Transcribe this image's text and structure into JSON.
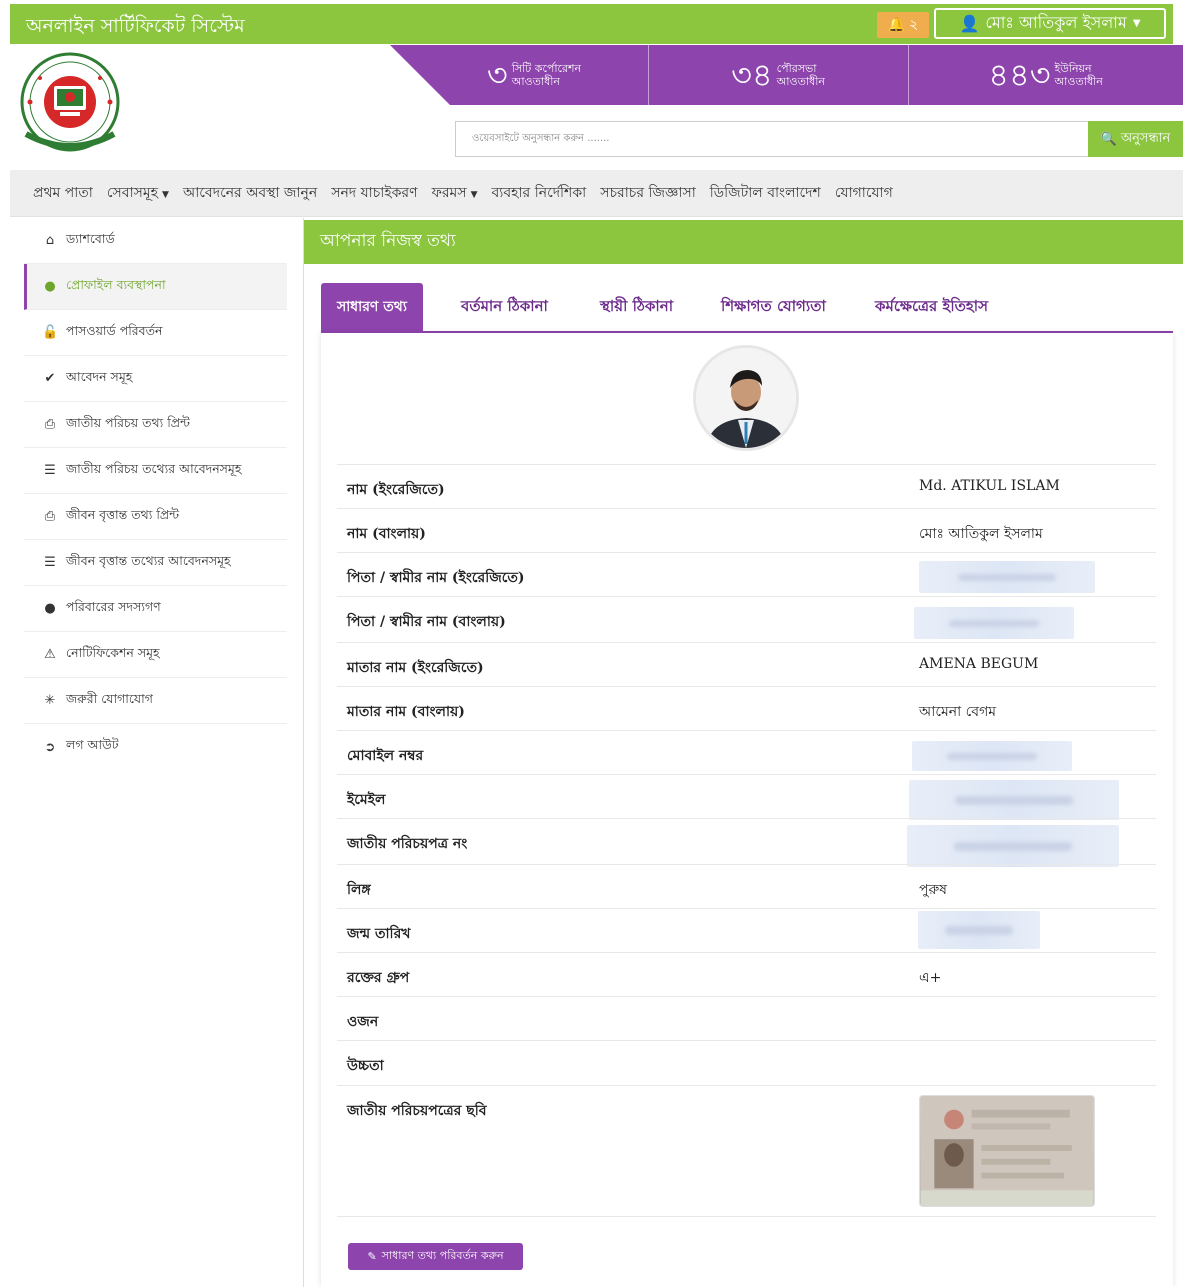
{
  "app": {
    "title": "অনলাইন সার্টিফিকেট সিস্টেম",
    "notification_count": "২",
    "user_name": "মোঃ আতিকুল ইসলাম"
  },
  "stats": [
    {
      "num": "৩",
      "label_line1": "সিটি কর্পোরেশন",
      "label_line2": "আওতাধীন"
    },
    {
      "num": "৩৪",
      "label_line1": "পৌরসভা",
      "label_line2": "আওতাধীন"
    },
    {
      "num": "৪৪৩",
      "label_line1": "ইউনিয়ন",
      "label_line2": "আওতাধীন"
    }
  ],
  "search": {
    "placeholder": "ওয়েবসাইটে অনুসন্ধান করুন .......",
    "button_label": "অনুসন্ধান"
  },
  "nav": [
    {
      "label": "প্রথম পাতা",
      "dropdown": false
    },
    {
      "label": "সেবাসমূহ",
      "dropdown": true
    },
    {
      "label": "আবেদনের অবস্থা জানুন",
      "dropdown": false
    },
    {
      "label": "সনদ যাচাইকরণ",
      "dropdown": false
    },
    {
      "label": "ফরমস",
      "dropdown": true
    },
    {
      "label": "ব্যবহার নির্দেশিকা",
      "dropdown": false
    },
    {
      "label": "সচরাচর জিজ্ঞাসা",
      "dropdown": false
    },
    {
      "label": "ডিজিটাল বাংলাদেশ",
      "dropdown": false
    },
    {
      "label": "যোগাযোগ",
      "dropdown": false
    }
  ],
  "sidebar": [
    {
      "label": "ড্যাশবোর্ড",
      "icon": "home-icon"
    },
    {
      "label": "প্রোফাইল ব্যবস্থাপনা",
      "icon": "user-icon",
      "active": true
    },
    {
      "label": "পাসওয়ার্ড পরিবর্তন",
      "icon": "lock-icon"
    },
    {
      "label": "আবেদন সমূহ",
      "icon": "check-icon"
    },
    {
      "label": "জাতীয় পরিচয় তথ্য প্রিন্ট",
      "icon": "print-icon"
    },
    {
      "label": "জাতীয় পরিচয় তথ্যের আবেদনসমূহ",
      "icon": "list-icon"
    },
    {
      "label": "জীবন বৃত্তান্ত তথ্য প্রিন্ট",
      "icon": "print-icon"
    },
    {
      "label": "জীবন বৃত্তান্ত তথ্যের আবেদনসমূহ",
      "icon": "list-icon"
    },
    {
      "label": "পরিবারের সদস্যগণ",
      "icon": "user-icon"
    },
    {
      "label": "নোটিফিকেশন সমূহ",
      "icon": "warning-icon"
    },
    {
      "label": "জরুরী যোগাযোগ",
      "icon": "asterisk-icon"
    },
    {
      "label": "লগ আউট",
      "icon": "logout-icon"
    }
  ],
  "panel": {
    "title": "আপনার নিজস্ব তথ্য",
    "tabs": [
      "সাধারণ তথ্য",
      "বর্তমান ঠিকানা",
      "স্থায়ী ঠিকানা",
      "শিক্ষাগত যোগ্যতা",
      "কর্মক্ষেত্রের ইতিহাস"
    ],
    "active_tab": 0
  },
  "profile": {
    "fields": [
      {
        "key": "নাম (ইংরেজিতে)",
        "value": "Md. ATIKUL ISLAM"
      },
      {
        "key": "নাম (বাংলায়)",
        "value": "মোঃ আতিকুল ইসলাম"
      },
      {
        "key": "পিতা / স্বামীর নাম (ইংরেজিতে)",
        "value": "",
        "redacted": true
      },
      {
        "key": "পিতা / স্বামীর নাম (বাংলায়)",
        "value": "",
        "redacted": true
      },
      {
        "key": "মাতার নাম (ইংরেজিতে)",
        "value": "AMENA BEGUM"
      },
      {
        "key": "মাতার নাম (বাংলায়)",
        "value": "আমেনা বেগম"
      },
      {
        "key": "মোবাইল নম্বর",
        "value": "",
        "redacted": true
      },
      {
        "key": "ইমেইল",
        "value": "",
        "redacted": true
      },
      {
        "key": "জাতীয় পরিচয়পত্র নং",
        "value": "",
        "redacted": true
      },
      {
        "key": "লিঙ্গ",
        "value": "পুরুষ"
      },
      {
        "key": "জন্ম তারিখ",
        "value": "",
        "redacted": true
      },
      {
        "key": "রক্তের গ্রুপ",
        "value": "এ+"
      },
      {
        "key": "ওজন",
        "value": ""
      },
      {
        "key": "উচ্চতা",
        "value": ""
      },
      {
        "key": "জাতীয় পরিচয়পত্রের ছবি",
        "value": ""
      }
    ],
    "edit_button": "সাধারণ তথ্য পরিবর্তন করুন"
  },
  "colors": {
    "green": "#8cc63f",
    "purple": "#8e44ad",
    "orange": "#f0ad4e"
  }
}
